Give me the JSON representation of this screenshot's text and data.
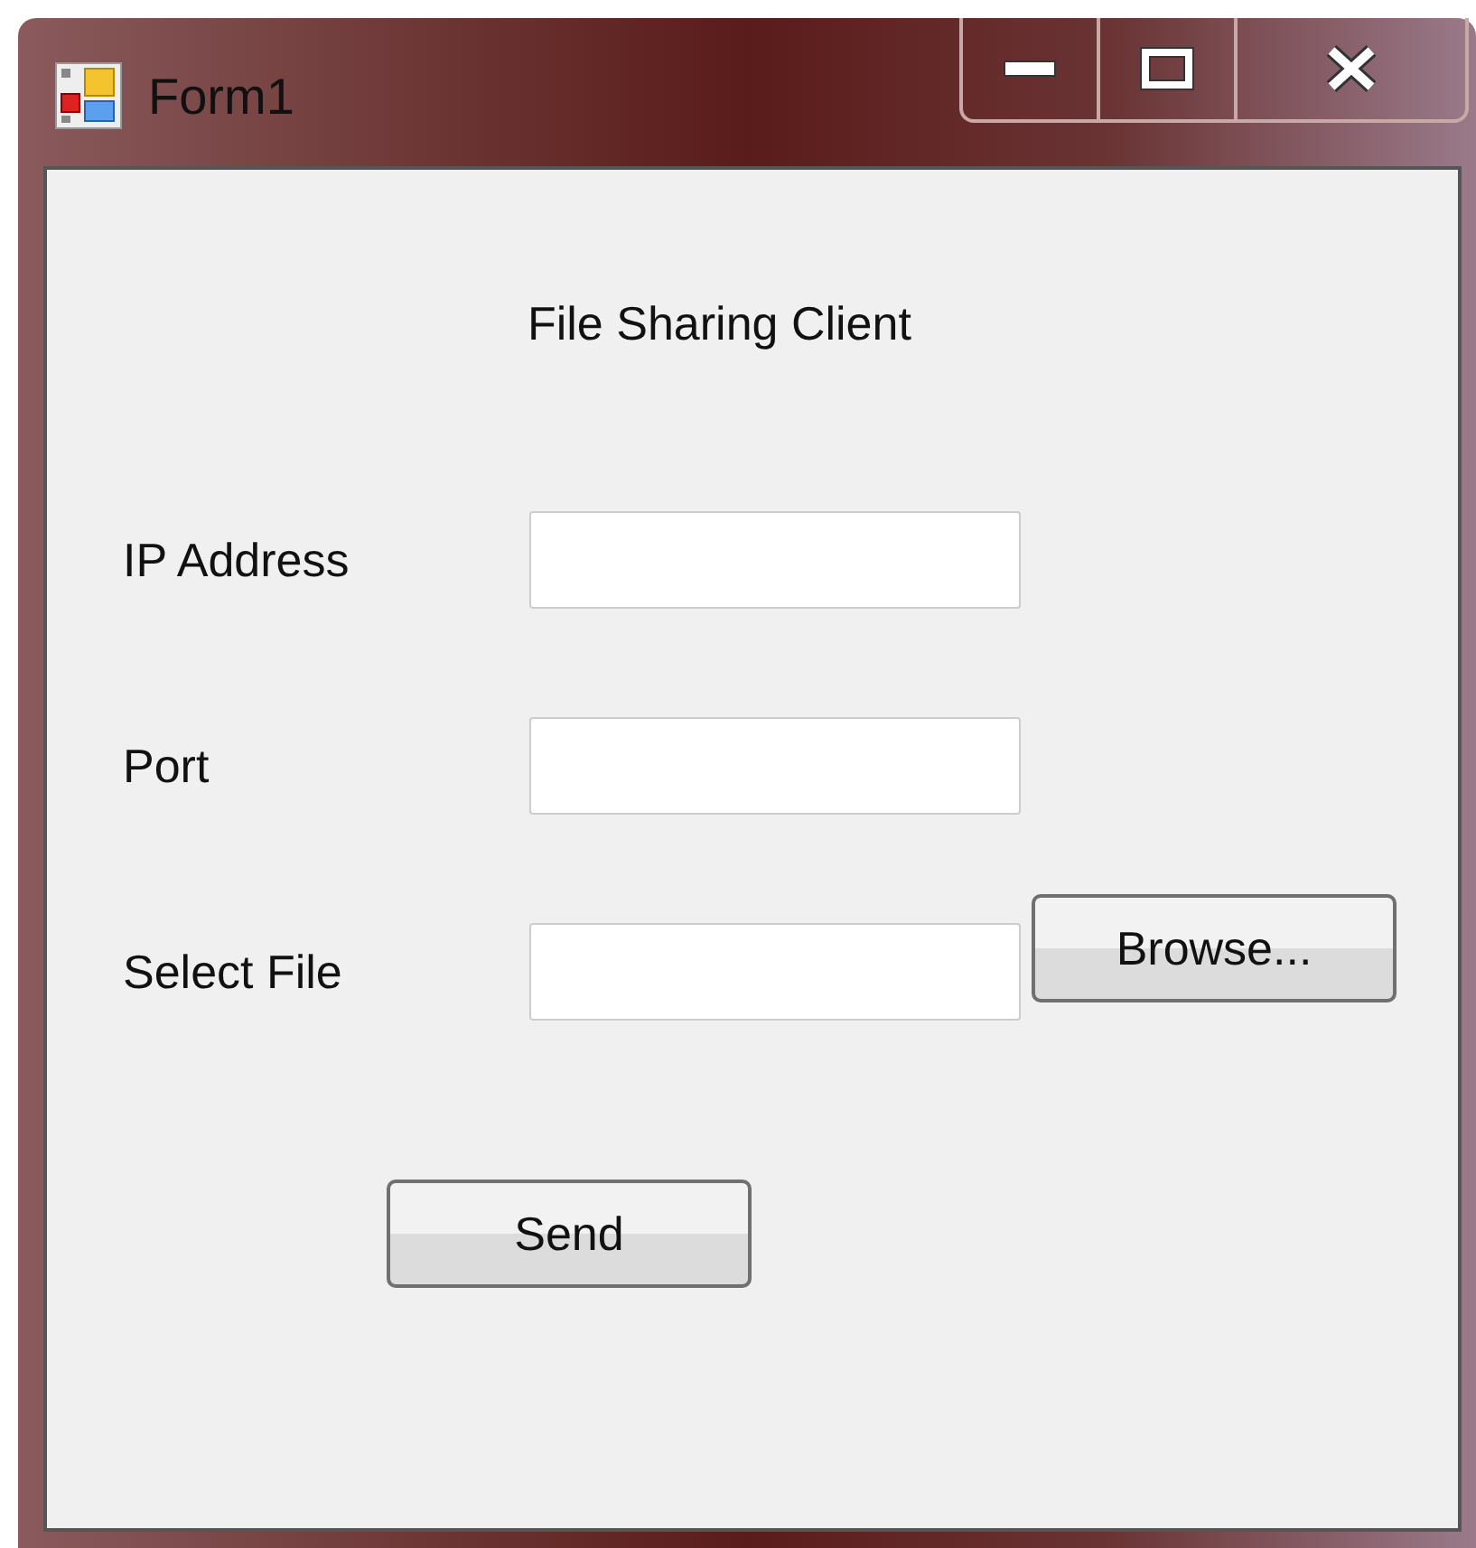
{
  "window": {
    "title": "Form1"
  },
  "heading": "File Sharing Client",
  "fields": [
    {
      "label": "IP Address"
    },
    {
      "label": "Port"
    },
    {
      "label": "Select File",
      "button": "Browse..."
    }
  ],
  "send_button": "Send"
}
